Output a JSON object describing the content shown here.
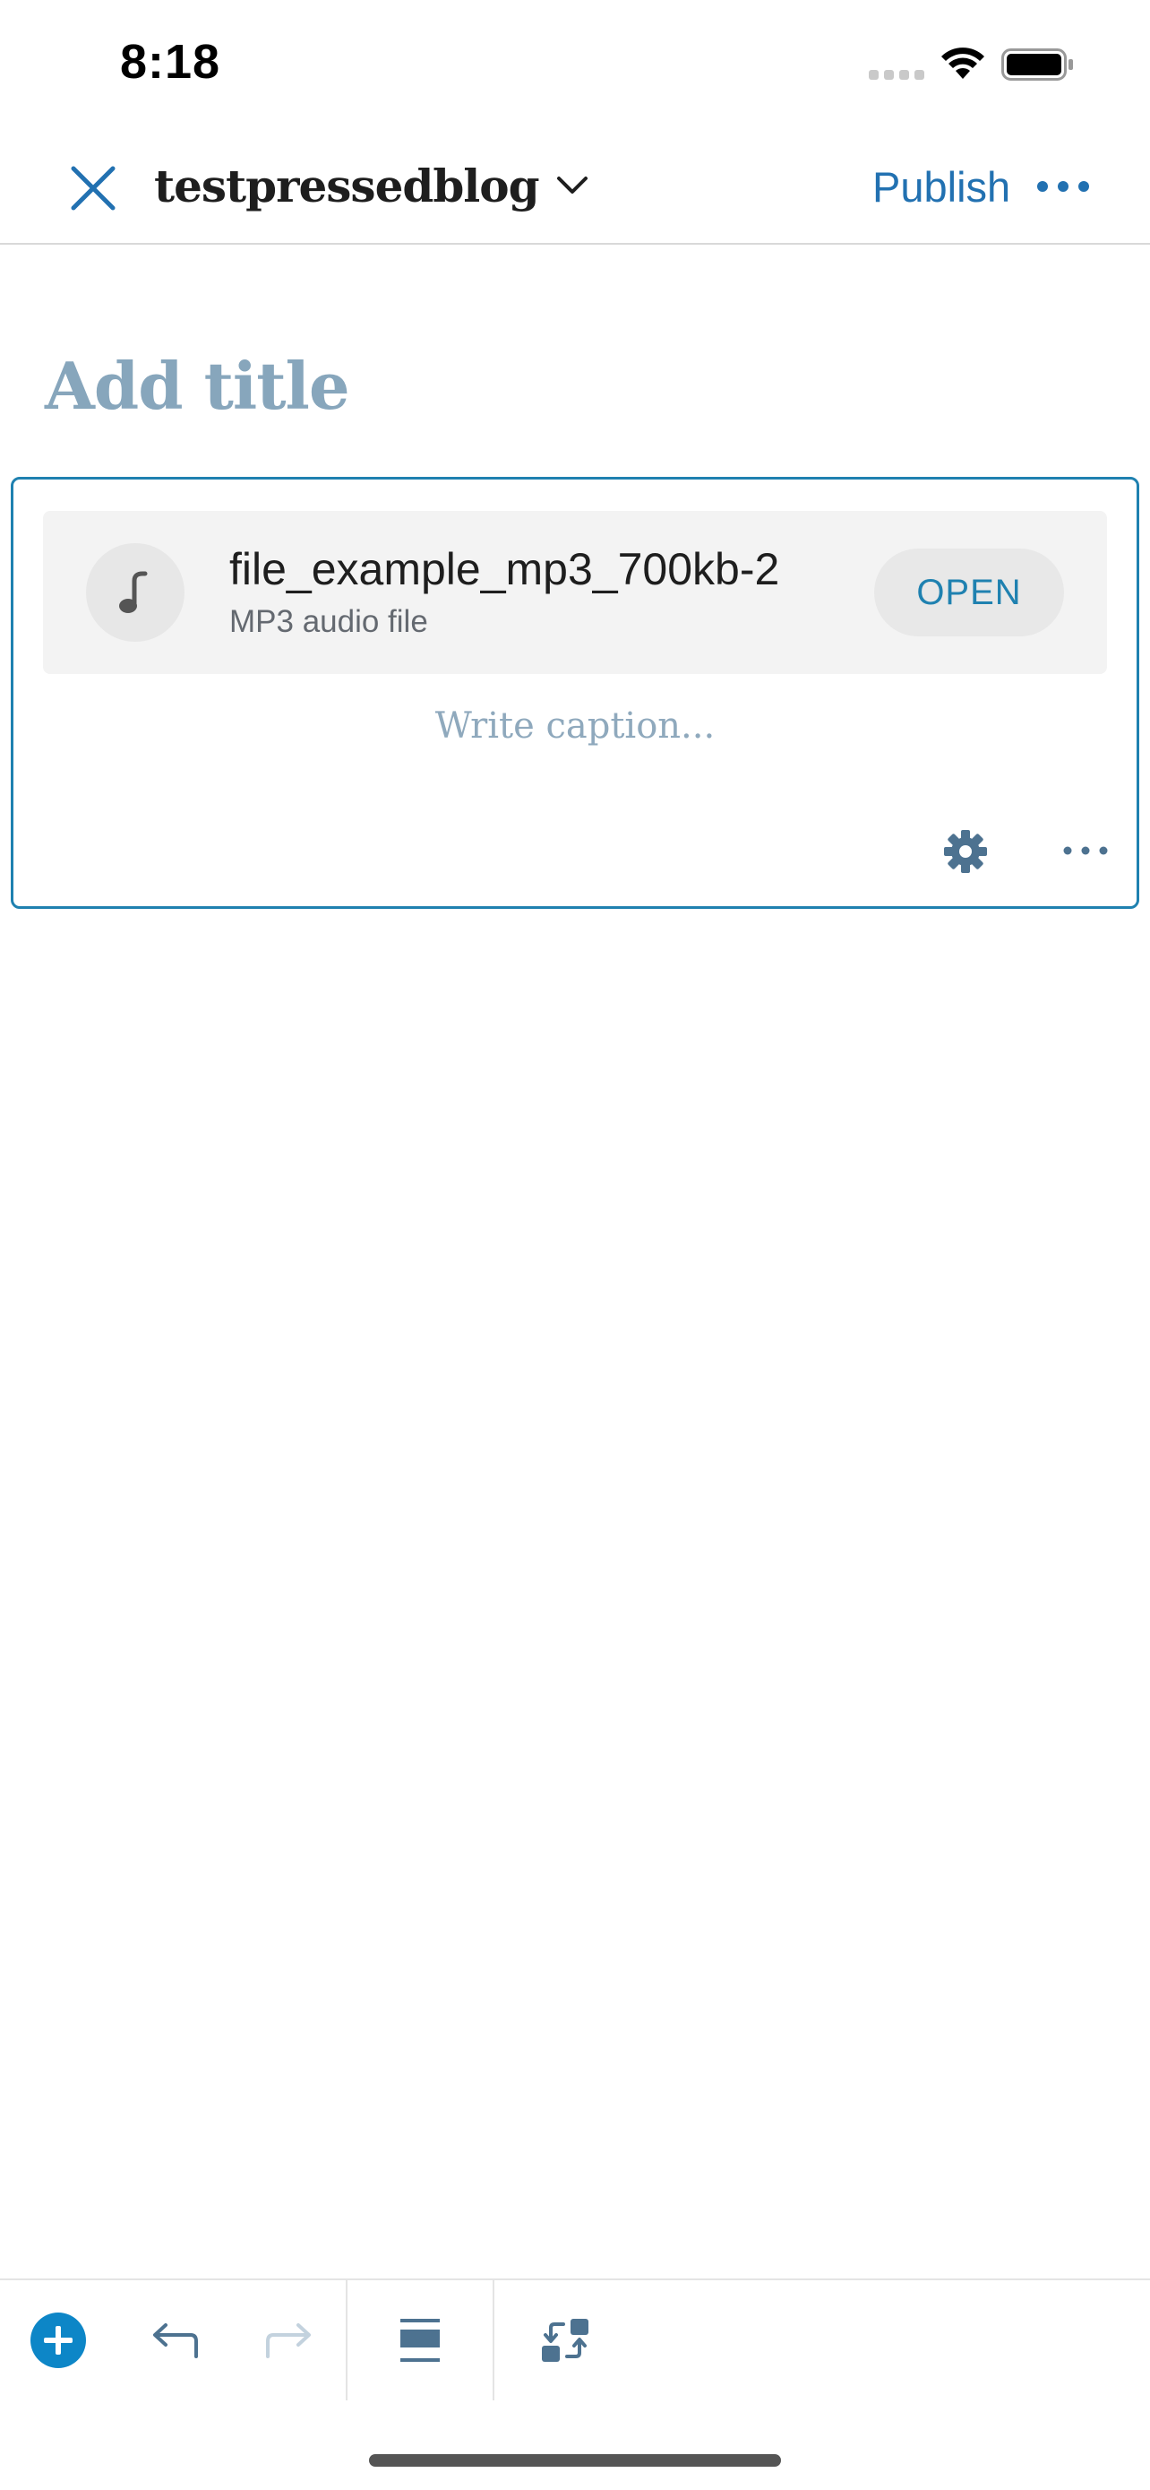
{
  "status_bar": {
    "time": "8:18"
  },
  "nav": {
    "site_name": "testpressedblog",
    "publish_label": "Publish",
    "close_icon": "close-icon",
    "chevron_icon": "chevron-down-icon",
    "more_icon": "more-horizontal-icon"
  },
  "editor": {
    "title_placeholder": "Add title",
    "file_block": {
      "file_name": "file_example_mp3_700kb-2",
      "file_type": "MP3 audio file",
      "open_label": "OPEN",
      "caption_placeholder": "Write caption...",
      "file_icon": "music-note-icon",
      "settings_icon": "gear-icon",
      "more_icon": "more-horizontal-icon"
    }
  },
  "toolbar": {
    "add_icon": "add-block-icon",
    "undo_icon": "undo-icon",
    "redo_icon": "redo-icon",
    "separator_block_icon": "separator-block-icon",
    "transform_icon": "transform-block-icon"
  },
  "colors": {
    "accent": "#2271b1",
    "block_border": "#1f81b0",
    "title_placeholder": "#87a6bc",
    "add_button": "#0d86c7"
  }
}
